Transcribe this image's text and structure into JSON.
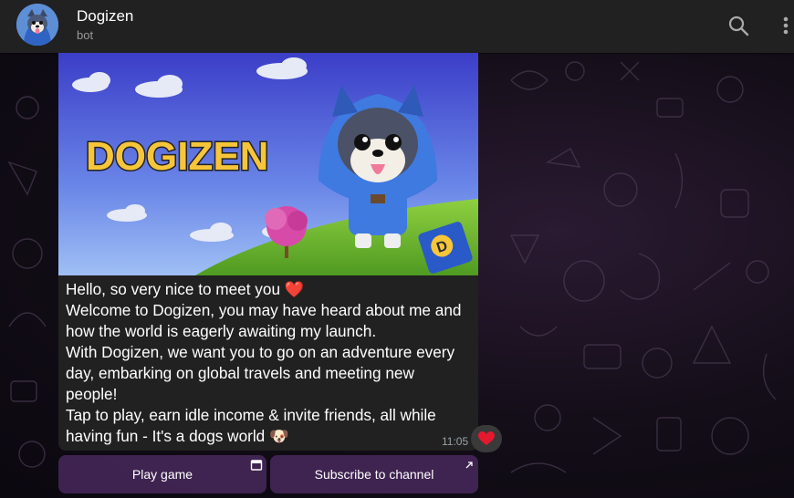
{
  "header": {
    "title": "Dogizen",
    "subtitle": "bot",
    "icons": [
      "search-icon",
      "more-vertical-icon"
    ]
  },
  "message": {
    "image_logo_text": "DOGIZEN",
    "lines": [
      "Hello, so very nice to meet you ❤️",
      "Welcome to Dogizen, you may have heard about me and how the world is eagerly awaiting my launch.",
      "With Dogizen, we want you to go on an adventure every day, embarking on global travels and meeting new people!",
      "Tap to play, earn idle income & invite friends, all while having fun - It's a dogs world 🐶"
    ],
    "time": "11:05",
    "reaction": "❤️"
  },
  "buttons": {
    "play_label": "Play game",
    "subscribe_label": "Subscribe to channel"
  },
  "colors": {
    "header_bg": "#212121",
    "bubble_bg": "#212121",
    "button_bg": "#48285c",
    "logo_yellow": "#f7c53a"
  }
}
